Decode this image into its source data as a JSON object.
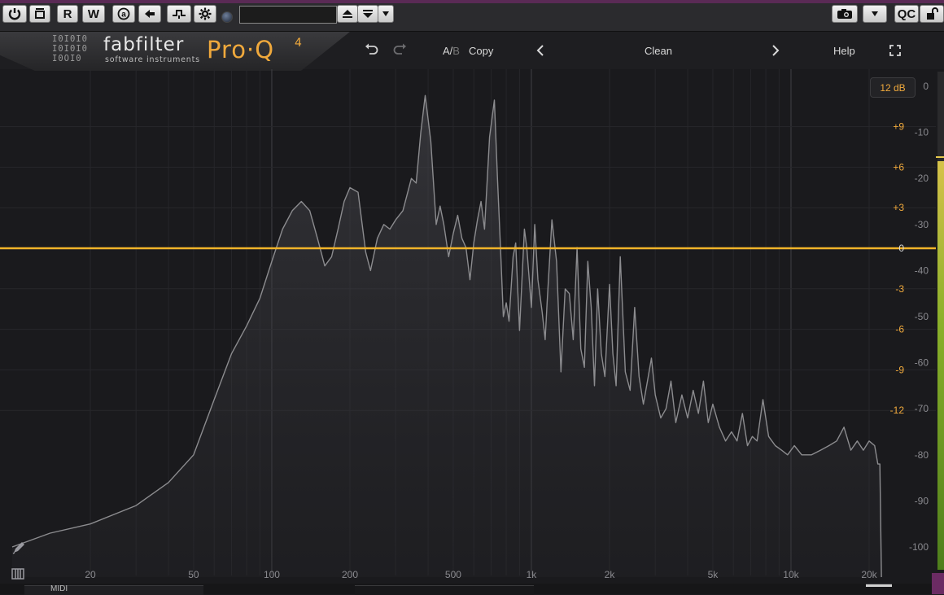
{
  "host_toolbar": {
    "buttons": [
      {
        "label": "",
        "icon": "power-icon"
      },
      {
        "label": "",
        "icon": "bypass-icon"
      },
      {
        "label": "R",
        "icon": ""
      },
      {
        "label": "W",
        "icon": ""
      },
      {
        "label": "",
        "icon": "automation-icon"
      },
      {
        "label": "",
        "icon": "arrow-left-icon"
      },
      {
        "label": "",
        "icon": "routing-icon"
      },
      {
        "label": "",
        "icon": "gear-icon"
      }
    ],
    "preset_value": "",
    "qc_label": "QC",
    "dropdown_icon": "chevron-down-icon"
  },
  "header": {
    "brand": "fabfilter",
    "brand_sub": "software instruments",
    "product": "Pro·Q",
    "product_version": "4",
    "ab_label_a": "A/",
    "ab_label_b": "B",
    "copy_label": "Copy",
    "preset_name": "Clean",
    "help_label": "Help"
  },
  "display": {
    "range_label": "12 dB",
    "eq_db_labels": [
      "+9",
      "+6",
      "+3",
      "0",
      "-3",
      "-6",
      "-9",
      "-12"
    ],
    "spectrum_db_labels": [
      "0",
      "-10",
      "-20",
      "-30",
      "-40",
      "-50",
      "-60",
      "-70",
      "-80",
      "-90",
      "-100"
    ],
    "freq_labels": [
      "20",
      "50",
      "100",
      "200",
      "500",
      "1k",
      "2k",
      "5k",
      "10k",
      "20k"
    ],
    "eq_gain_db": 0,
    "meter_level_fraction": 0.82,
    "colors": {
      "eq_curve": "#f0b429",
      "eq_db_text": "#f0a93c",
      "spectrum_line": "#8c8c8f",
      "grid": "#2c2c30",
      "background": "#1a1a1d"
    }
  },
  "spectrum": {
    "points": [
      [
        10,
        -100
      ],
      [
        14,
        -97
      ],
      [
        20,
        -95
      ],
      [
        30,
        -91
      ],
      [
        40,
        -86
      ],
      [
        50,
        -80
      ],
      [
        60,
        -68
      ],
      [
        70,
        -58
      ],
      [
        80,
        -52
      ],
      [
        90,
        -46
      ],
      [
        100,
        -38
      ],
      [
        110,
        -31
      ],
      [
        120,
        -27
      ],
      [
        130,
        -25
      ],
      [
        140,
        -27
      ],
      [
        150,
        -33
      ],
      [
        160,
        -39
      ],
      [
        170,
        -37
      ],
      [
        180,
        -31
      ],
      [
        190,
        -25
      ],
      [
        200,
        -22
      ],
      [
        215,
        -23
      ],
      [
        230,
        -36
      ],
      [
        240,
        -40
      ],
      [
        255,
        -33
      ],
      [
        270,
        -30
      ],
      [
        285,
        -31
      ],
      [
        300,
        -29
      ],
      [
        320,
        -27
      ],
      [
        345,
        -20
      ],
      [
        360,
        -21
      ],
      [
        375,
        -10
      ],
      [
        390,
        -2
      ],
      [
        410,
        -12
      ],
      [
        430,
        -30
      ],
      [
        445,
        -26
      ],
      [
        460,
        -30
      ],
      [
        480,
        -37
      ],
      [
        500,
        -32
      ],
      [
        520,
        -28
      ],
      [
        540,
        -33
      ],
      [
        560,
        -35
      ],
      [
        580,
        -42
      ],
      [
        600,
        -34
      ],
      [
        620,
        -29
      ],
      [
        640,
        -25
      ],
      [
        660,
        -31
      ],
      [
        690,
        -11
      ],
      [
        720,
        -3
      ],
      [
        740,
        -20
      ],
      [
        760,
        -35
      ],
      [
        780,
        -50
      ],
      [
        800,
        -47
      ],
      [
        820,
        -51
      ],
      [
        850,
        -37
      ],
      [
        870,
        -34
      ],
      [
        900,
        -53
      ],
      [
        940,
        -31
      ],
      [
        960,
        -35
      ],
      [
        1000,
        -48
      ],
      [
        1030,
        -30
      ],
      [
        1060,
        -42
      ],
      [
        1100,
        -49
      ],
      [
        1130,
        -55
      ],
      [
        1150,
        -47
      ],
      [
        1200,
        -29
      ],
      [
        1250,
        -38
      ],
      [
        1300,
        -62
      ],
      [
        1350,
        -44
      ],
      [
        1400,
        -45
      ],
      [
        1450,
        -55
      ],
      [
        1500,
        -35
      ],
      [
        1550,
        -57
      ],
      [
        1600,
        -61
      ],
      [
        1650,
        -38
      ],
      [
        1700,
        -48
      ],
      [
        1750,
        -65
      ],
      [
        1800,
        -44
      ],
      [
        1860,
        -58
      ],
      [
        1920,
        -63
      ],
      [
        2000,
        -43
      ],
      [
        2060,
        -58
      ],
      [
        2120,
        -65
      ],
      [
        2200,
        -37
      ],
      [
        2300,
        -62
      ],
      [
        2400,
        -66
      ],
      [
        2500,
        -48
      ],
      [
        2600,
        -63
      ],
      [
        2700,
        -69
      ],
      [
        2800,
        -64
      ],
      [
        2900,
        -59
      ],
      [
        3000,
        -67
      ],
      [
        3150,
        -72
      ],
      [
        3300,
        -70
      ],
      [
        3450,
        -64
      ],
      [
        3600,
        -73
      ],
      [
        3800,
        -67
      ],
      [
        4000,
        -72
      ],
      [
        4200,
        -66
      ],
      [
        4400,
        -71
      ],
      [
        4600,
        -64
      ],
      [
        4800,
        -73
      ],
      [
        5000,
        -69
      ],
      [
        5300,
        -74
      ],
      [
        5600,
        -77
      ],
      [
        5900,
        -75
      ],
      [
        6200,
        -77
      ],
      [
        6500,
        -71
      ],
      [
        6800,
        -78
      ],
      [
        7100,
        -76
      ],
      [
        7400,
        -77
      ],
      [
        7800,
        -68
      ],
      [
        8200,
        -76
      ],
      [
        8700,
        -78
      ],
      [
        9200,
        -79
      ],
      [
        9700,
        -80
      ],
      [
        10300,
        -78
      ],
      [
        11000,
        -80
      ],
      [
        12000,
        -80
      ],
      [
        13000,
        -79
      ],
      [
        14000,
        -78
      ],
      [
        15000,
        -77
      ],
      [
        16000,
        -74
      ],
      [
        17000,
        -79
      ],
      [
        18000,
        -77
      ],
      [
        19000,
        -79
      ],
      [
        20000,
        -77
      ],
      [
        21000,
        -78
      ],
      [
        21600,
        -82
      ],
      [
        22000,
        -82
      ],
      [
        22300,
        -112
      ]
    ]
  },
  "footer": {
    "tabs": [
      "MIDI",
      "",
      "",
      ""
    ]
  }
}
